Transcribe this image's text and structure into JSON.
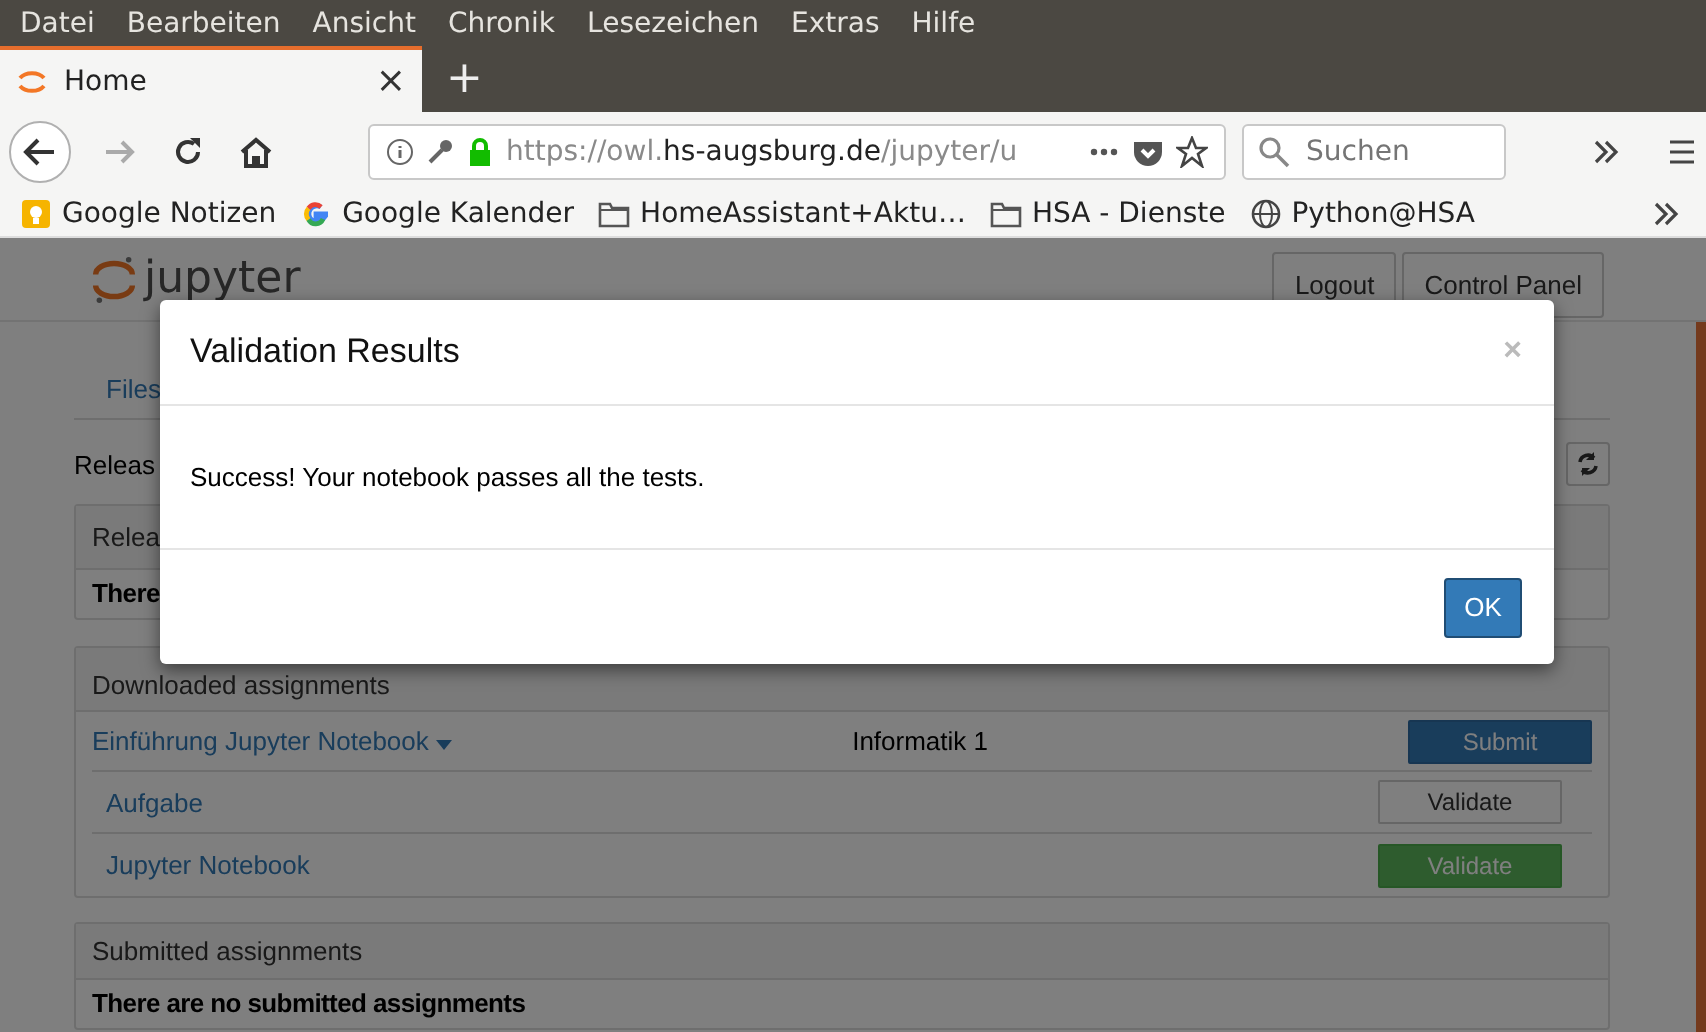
{
  "menu_bar": [
    {
      "label": "Datei"
    },
    {
      "label": "Bearbeiten"
    },
    {
      "label": "Ansicht"
    },
    {
      "label": "Chronik"
    },
    {
      "label": "Lesezeichen"
    },
    {
      "label": "Extras"
    },
    {
      "label": "Hilfe"
    }
  ],
  "browser_tab": {
    "title": "Home",
    "close": "×",
    "new_tab": "+"
  },
  "address_bar": {
    "url_prefix": "https://owl.",
    "url_domain": "hs-augsburg.de",
    "url_path": "/jupyter/u"
  },
  "search": {
    "placeholder": "Suchen"
  },
  "bookmarks": [
    {
      "label": "Google Notizen",
      "kind": "notes"
    },
    {
      "label": "Google Kalender",
      "kind": "google"
    },
    {
      "label": "HomeAssistant+Aktu…",
      "kind": "folder"
    },
    {
      "label": "HSA - Dienste",
      "kind": "folder"
    },
    {
      "label": "Python@HSA",
      "kind": "globe"
    }
  ],
  "header": {
    "logo": "jupyter",
    "buttons": [
      "Logout",
      "Control Panel"
    ]
  },
  "tabs": [
    {
      "label": "Files"
    }
  ],
  "released_label": "Releas",
  "released_panel": {
    "heading": "Relea",
    "message": "There"
  },
  "downloaded_panel": {
    "heading": "Downloaded assignments",
    "course": {
      "name": "Einführung Jupyter Notebook",
      "course_id": "Informatik 1",
      "action": "Submit"
    },
    "notebooks": [
      {
        "name": "Aufgabe",
        "action": "Validate",
        "kind": "default"
      },
      {
        "name": "Jupyter Notebook",
        "action": "Validate",
        "kind": "success"
      }
    ]
  },
  "submitted_panel": {
    "heading": "Submitted assignments",
    "message": "There are no submitted assignments"
  },
  "modal": {
    "title": "Validation Results",
    "close": "×",
    "message": "Success! Your notebook passes all the tests.",
    "ok": "OK"
  }
}
